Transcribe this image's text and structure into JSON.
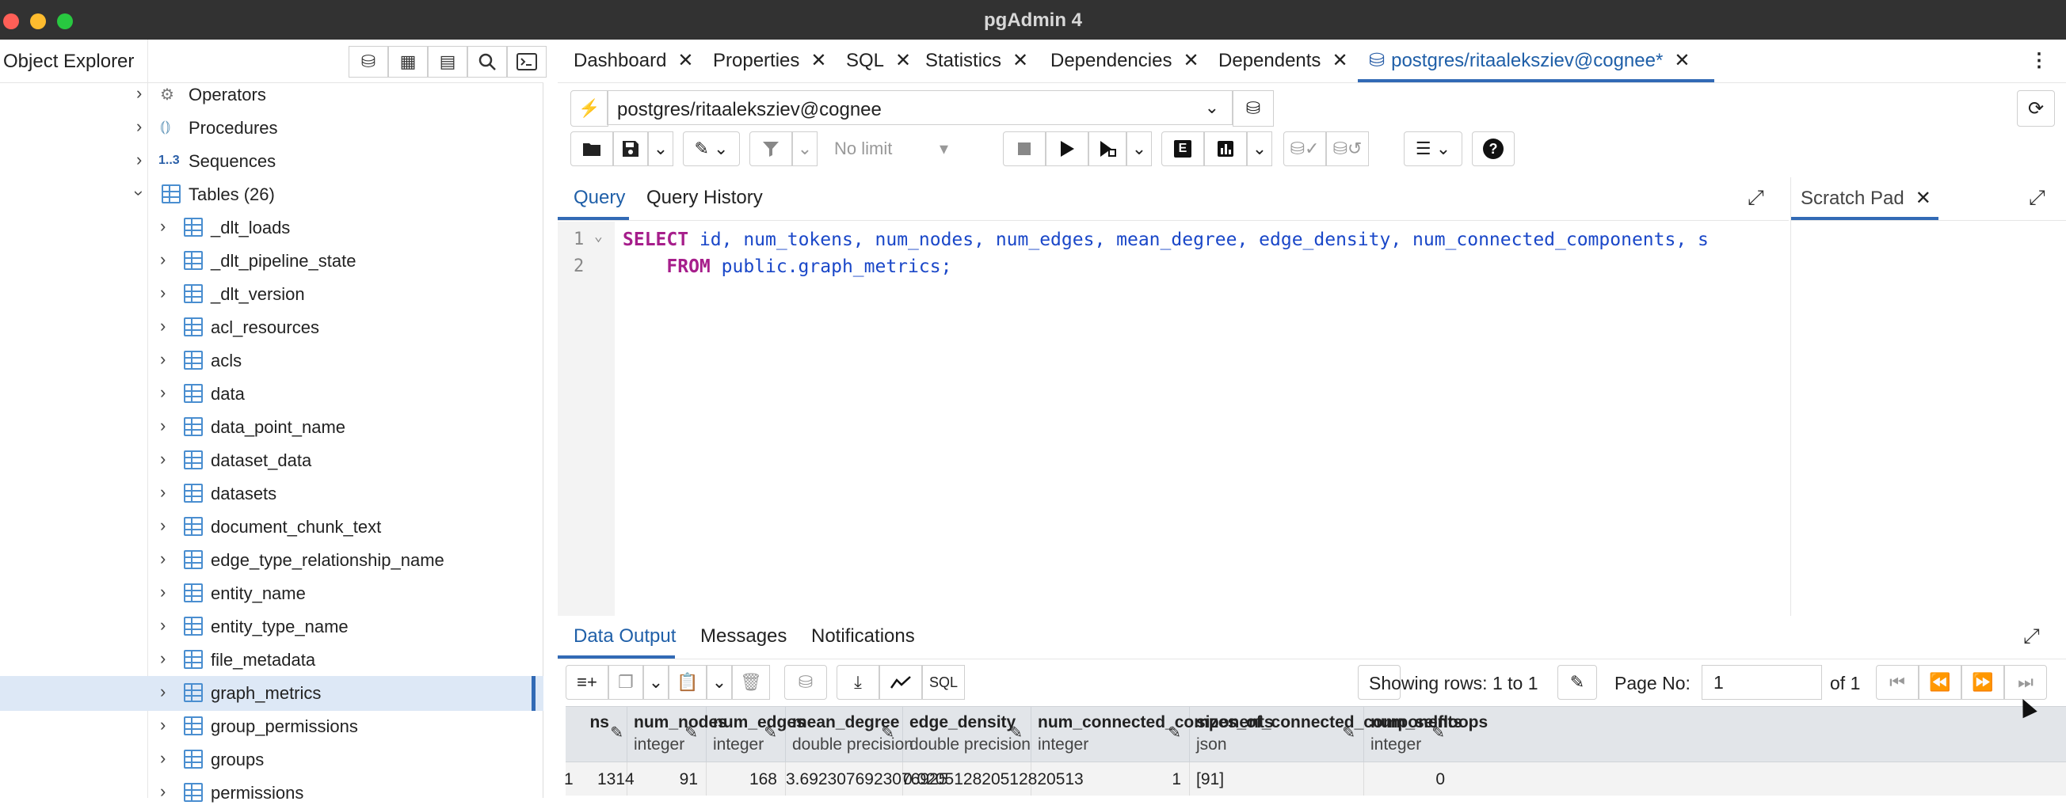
{
  "window": {
    "title": "pgAdmin 4"
  },
  "object_explorer": {
    "title": "Object Explorer",
    "tree": [
      {
        "label": "Operators",
        "level": 1,
        "icon": "operator-icon"
      },
      {
        "label": "Procedures",
        "level": 1,
        "icon": "procedure-icon"
      },
      {
        "label": "Sequences",
        "level": 1,
        "icon": "sequence-icon",
        "prefix": "1..3"
      },
      {
        "label": "Tables (26)",
        "level": 1,
        "icon": "tables-icon",
        "expanded": true
      },
      {
        "label": "_dlt_loads",
        "level": 2,
        "icon": "table-icon"
      },
      {
        "label": "_dlt_pipeline_state",
        "level": 2,
        "icon": "table-icon"
      },
      {
        "label": "_dlt_version",
        "level": 2,
        "icon": "table-icon"
      },
      {
        "label": "acl_resources",
        "level": 2,
        "icon": "table-icon"
      },
      {
        "label": "acls",
        "level": 2,
        "icon": "table-icon"
      },
      {
        "label": "data",
        "level": 2,
        "icon": "table-icon"
      },
      {
        "label": "data_point_name",
        "level": 2,
        "icon": "table-icon"
      },
      {
        "label": "dataset_data",
        "level": 2,
        "icon": "table-icon"
      },
      {
        "label": "datasets",
        "level": 2,
        "icon": "table-icon"
      },
      {
        "label": "document_chunk_text",
        "level": 2,
        "icon": "table-icon"
      },
      {
        "label": "edge_type_relationship_name",
        "level": 2,
        "icon": "table-icon"
      },
      {
        "label": "entity_name",
        "level": 2,
        "icon": "table-icon"
      },
      {
        "label": "entity_type_name",
        "level": 2,
        "icon": "table-icon"
      },
      {
        "label": "file_metadata",
        "level": 2,
        "icon": "table-icon"
      },
      {
        "label": "graph_metrics",
        "level": 2,
        "icon": "table-icon",
        "selected": true
      },
      {
        "label": "group_permissions",
        "level": 2,
        "icon": "table-icon"
      },
      {
        "label": "groups",
        "level": 2,
        "icon": "table-icon"
      },
      {
        "label": "permissions",
        "level": 2,
        "icon": "table-icon"
      }
    ]
  },
  "tabs": [
    {
      "label": "Dashboard"
    },
    {
      "label": "Properties"
    },
    {
      "label": "SQL"
    },
    {
      "label": "Statistics"
    },
    {
      "label": "Dependencies"
    },
    {
      "label": "Dependents"
    },
    {
      "label": "postgres/ritaaleksziev@cognee*",
      "active": true
    }
  ],
  "connection": {
    "value": "postgres/ritaaleksziev@cognee"
  },
  "toolbar": {
    "limit_label": "No limit"
  },
  "query": {
    "tabs": [
      "Query",
      "Query History"
    ],
    "lines": [
      {
        "num": "1",
        "keyword": "SELECT",
        "text": " id, num_tokens, num_nodes, num_edges, mean_degree, edge_density, num_connected_components, s"
      },
      {
        "num": "2",
        "keyword": "    FROM",
        "text": " public.graph_metrics;"
      }
    ]
  },
  "scratch_pad": {
    "title": "Scratch Pad"
  },
  "data_output": {
    "tabs": [
      "Data Output",
      "Messages",
      "Notifications"
    ],
    "showing": "Showing rows: 1 to 1",
    "page_label": "Page No:",
    "page_value": "1",
    "page_of": "of 1",
    "sql_label": "SQL",
    "columns": [
      {
        "name": "ns",
        "type": ""
      },
      {
        "name": "num_nodes",
        "type": "integer"
      },
      {
        "name": "num_edges",
        "type": "integer"
      },
      {
        "name": "mean_degree",
        "type": "double precision"
      },
      {
        "name": "edge_density",
        "type": "double precision"
      },
      {
        "name": "num_connected_components",
        "type": "integer"
      },
      {
        "name": "sizes_of_connected_components",
        "type": "json"
      },
      {
        "name": "num_selfloops",
        "type": "integer"
      }
    ],
    "row": {
      "index": "1",
      "cells": [
        "1314",
        "91",
        "168",
        "3.6923076923076925",
        "0.020512820512820513",
        "1",
        "[91]",
        "0"
      ]
    }
  }
}
